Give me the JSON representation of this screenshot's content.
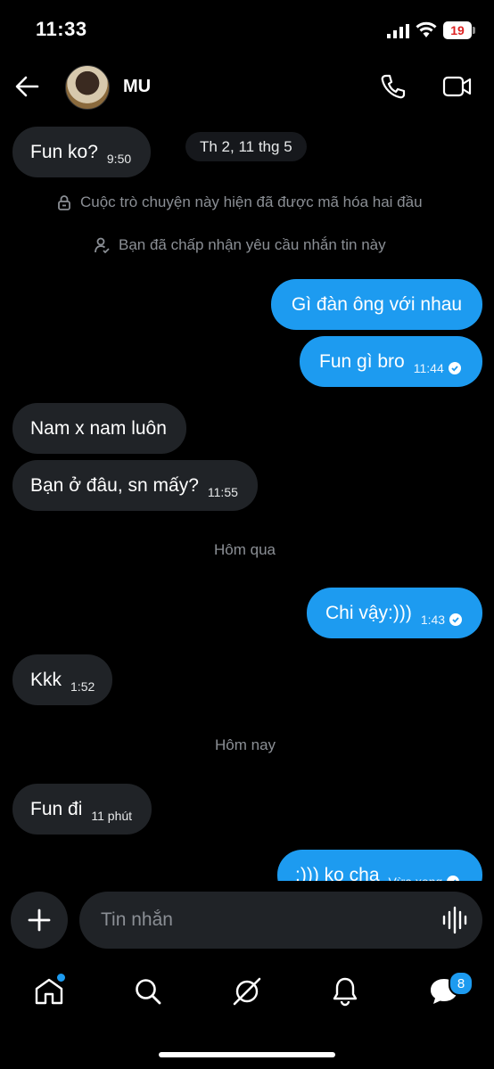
{
  "status_bar": {
    "time": "11:33",
    "battery": "19"
  },
  "header": {
    "name": "MU"
  },
  "date_chip": "Th 2, 11 thg 5",
  "notices": {
    "encrypted": "Cuộc trò chuyện này hiện đã được mã hóa hai đầu",
    "accepted": "Bạn đã chấp nhận yêu cầu nhắn tin này"
  },
  "separators": {
    "yesterday": "Hôm qua",
    "today": "Hôm nay"
  },
  "messages": [
    {
      "text": "Fun ko?",
      "time": "9:50"
    },
    {
      "text": "Gì đàn ông với nhau",
      "time": ""
    },
    {
      "text": "Fun gì bro",
      "time": "11:44"
    },
    {
      "text": "Nam x nam luôn",
      "time": ""
    },
    {
      "text": "Bạn ở đâu, sn mấy?",
      "time": "11:55"
    },
    {
      "text": "Chi vậy:)))",
      "time": "1:43"
    },
    {
      "text": "Kkk",
      "time": "1:52"
    },
    {
      "text": "Fun đi",
      "time": "11 phút"
    },
    {
      "text": ":))) ko cha",
      "time": "Vừa xong"
    }
  ],
  "composer": {
    "placeholder": "Tin nhắn"
  },
  "nav": {
    "messages_badge": "8"
  },
  "colors": {
    "accent": "#1d9bf0",
    "incoming_bubble": "#202327",
    "background": "#000000"
  }
}
